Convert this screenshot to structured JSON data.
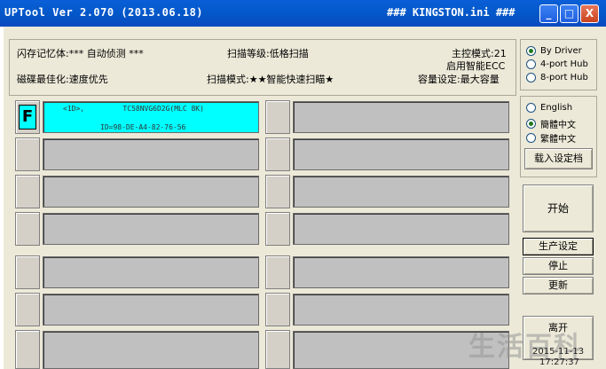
{
  "window": {
    "title": "UPTool Ver 2.070 (2013.06.18)",
    "title_right": "### KINGSTON.ini ###",
    "min_symbol": "_",
    "max_symbol": "□",
    "close_symbol": "X"
  },
  "info": {
    "flash": "闪存记忆体:*** 自动侦测 ***",
    "scan_level": "扫描等级:低格扫描",
    "controller_mode": "主控模式:21",
    "ecc": "启用智能ECC",
    "disk_opt": "磁碟最佳化:速度优先",
    "scan_mode": "扫描模式:★★智能快速扫瞄★",
    "capacity": "容量设定:最大容量"
  },
  "hub_options": [
    {
      "label": "By Driver",
      "checked": true
    },
    {
      "label": "4-port Hub",
      "checked": false
    },
    {
      "label": "8-port Hub",
      "checked": false
    }
  ],
  "language_options": [
    {
      "label": "English",
      "checked": false
    },
    {
      "label": "簡體中文",
      "checked": true
    },
    {
      "label": "繁體中文",
      "checked": false
    }
  ],
  "buttons": {
    "load_settings": "载入设定档",
    "start": "开始",
    "production_settings": "生产设定",
    "stop": "停止",
    "update": "更新",
    "exit": "离开"
  },
  "ports": {
    "active_letter": "F",
    "active_line1": "<1D>,         TC58NVG6D2G(MLC 8K)",
    "active_line2": "ID=98-DE-A4-82-76-56"
  },
  "watermark": "生活百科",
  "datetime": {
    "date": "2015-11-13",
    "time": "17:27:37"
  }
}
